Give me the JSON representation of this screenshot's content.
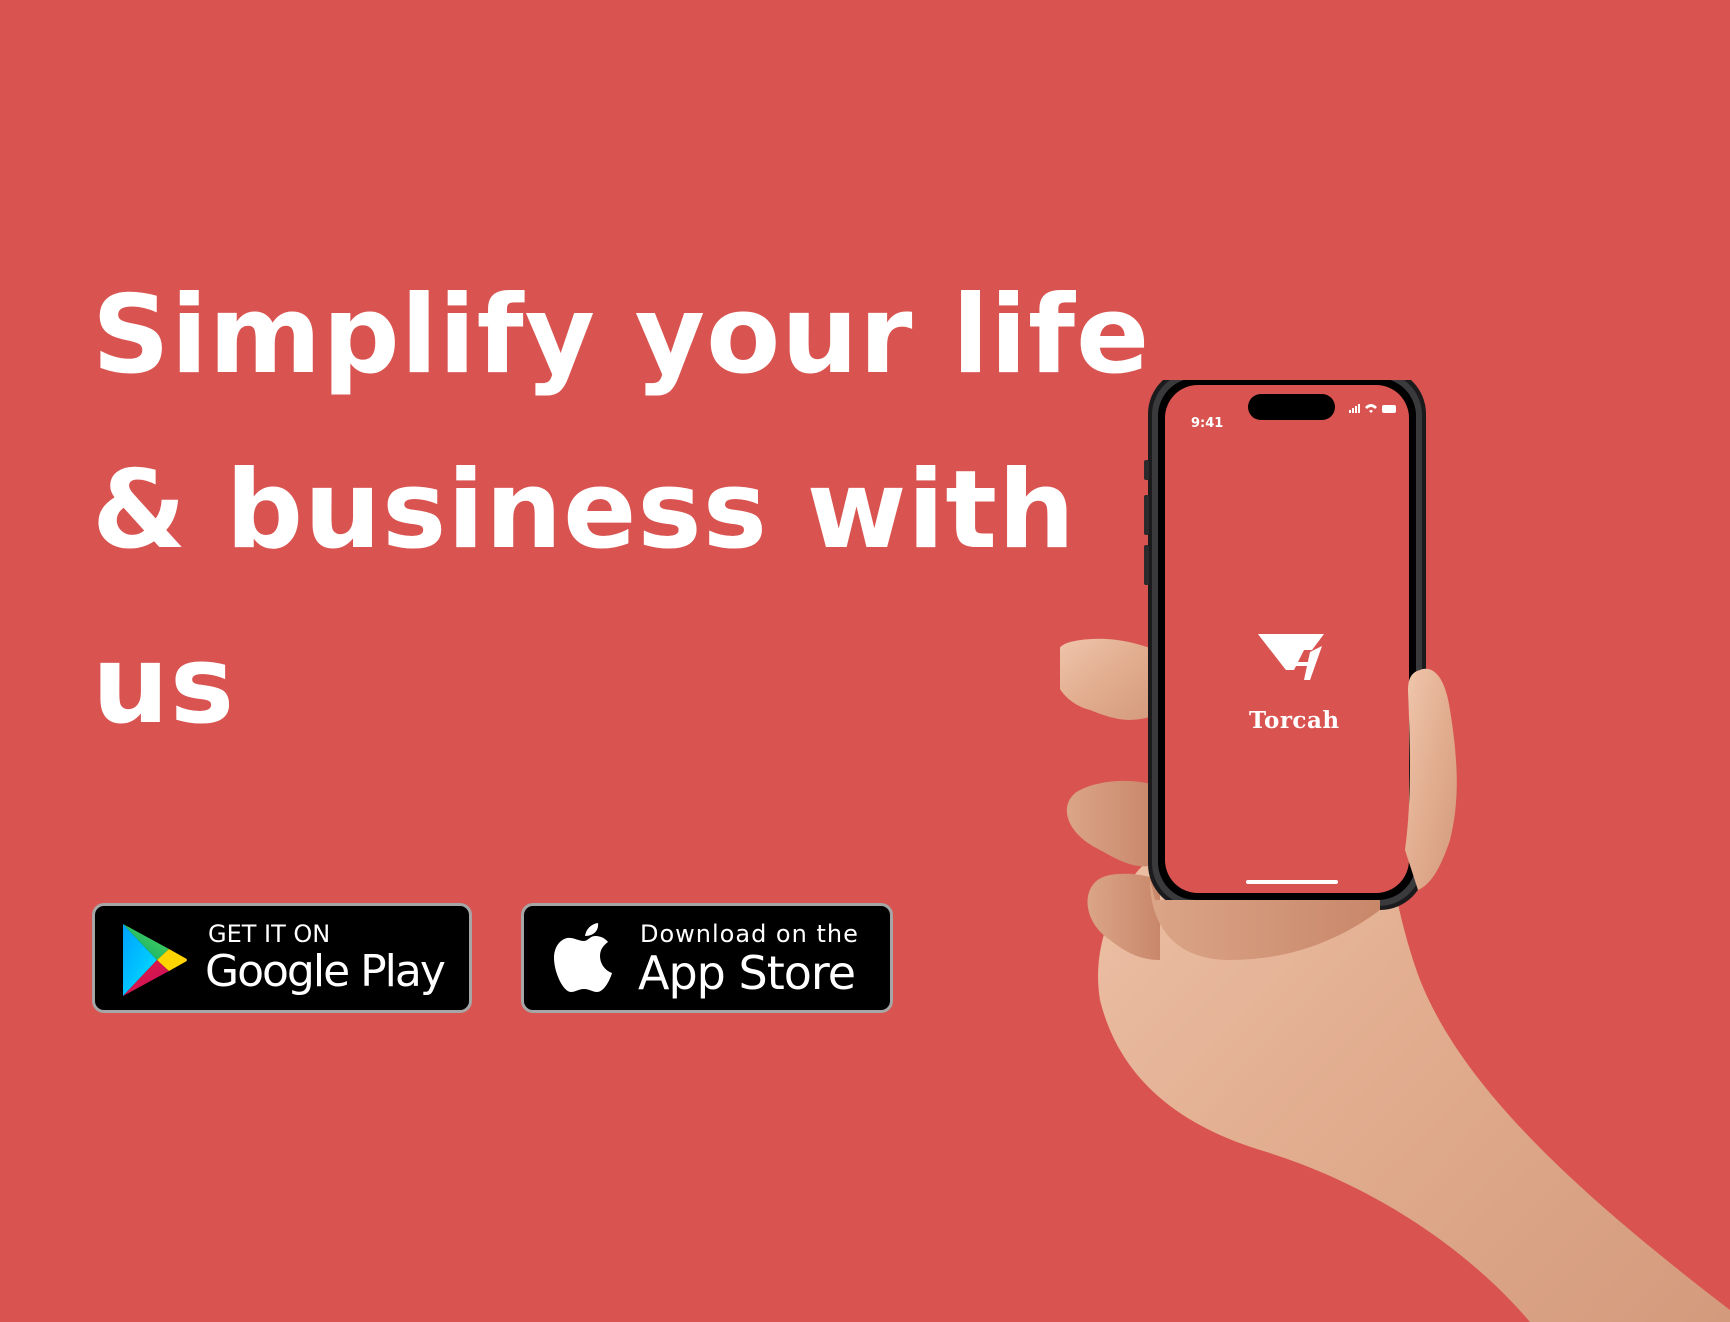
{
  "headline": {
    "line1": "Simplify your life",
    "line2": "& business with",
    "line3": "us"
  },
  "google_badge": {
    "small_text": "GET IT ON",
    "big_text": "Google Play",
    "icon": "google-play-icon"
  },
  "apple_badge": {
    "small_text": "Download on the",
    "big_text": "App Store",
    "icon": "apple-icon"
  },
  "phone": {
    "status_time": "9:41",
    "app_name": "Torcah",
    "app_logo": "torcah-logo"
  },
  "colors": {
    "background": "#d95450",
    "text": "#ffffff",
    "badge_bg": "#000000",
    "badge_border": "#a6a6a6"
  }
}
